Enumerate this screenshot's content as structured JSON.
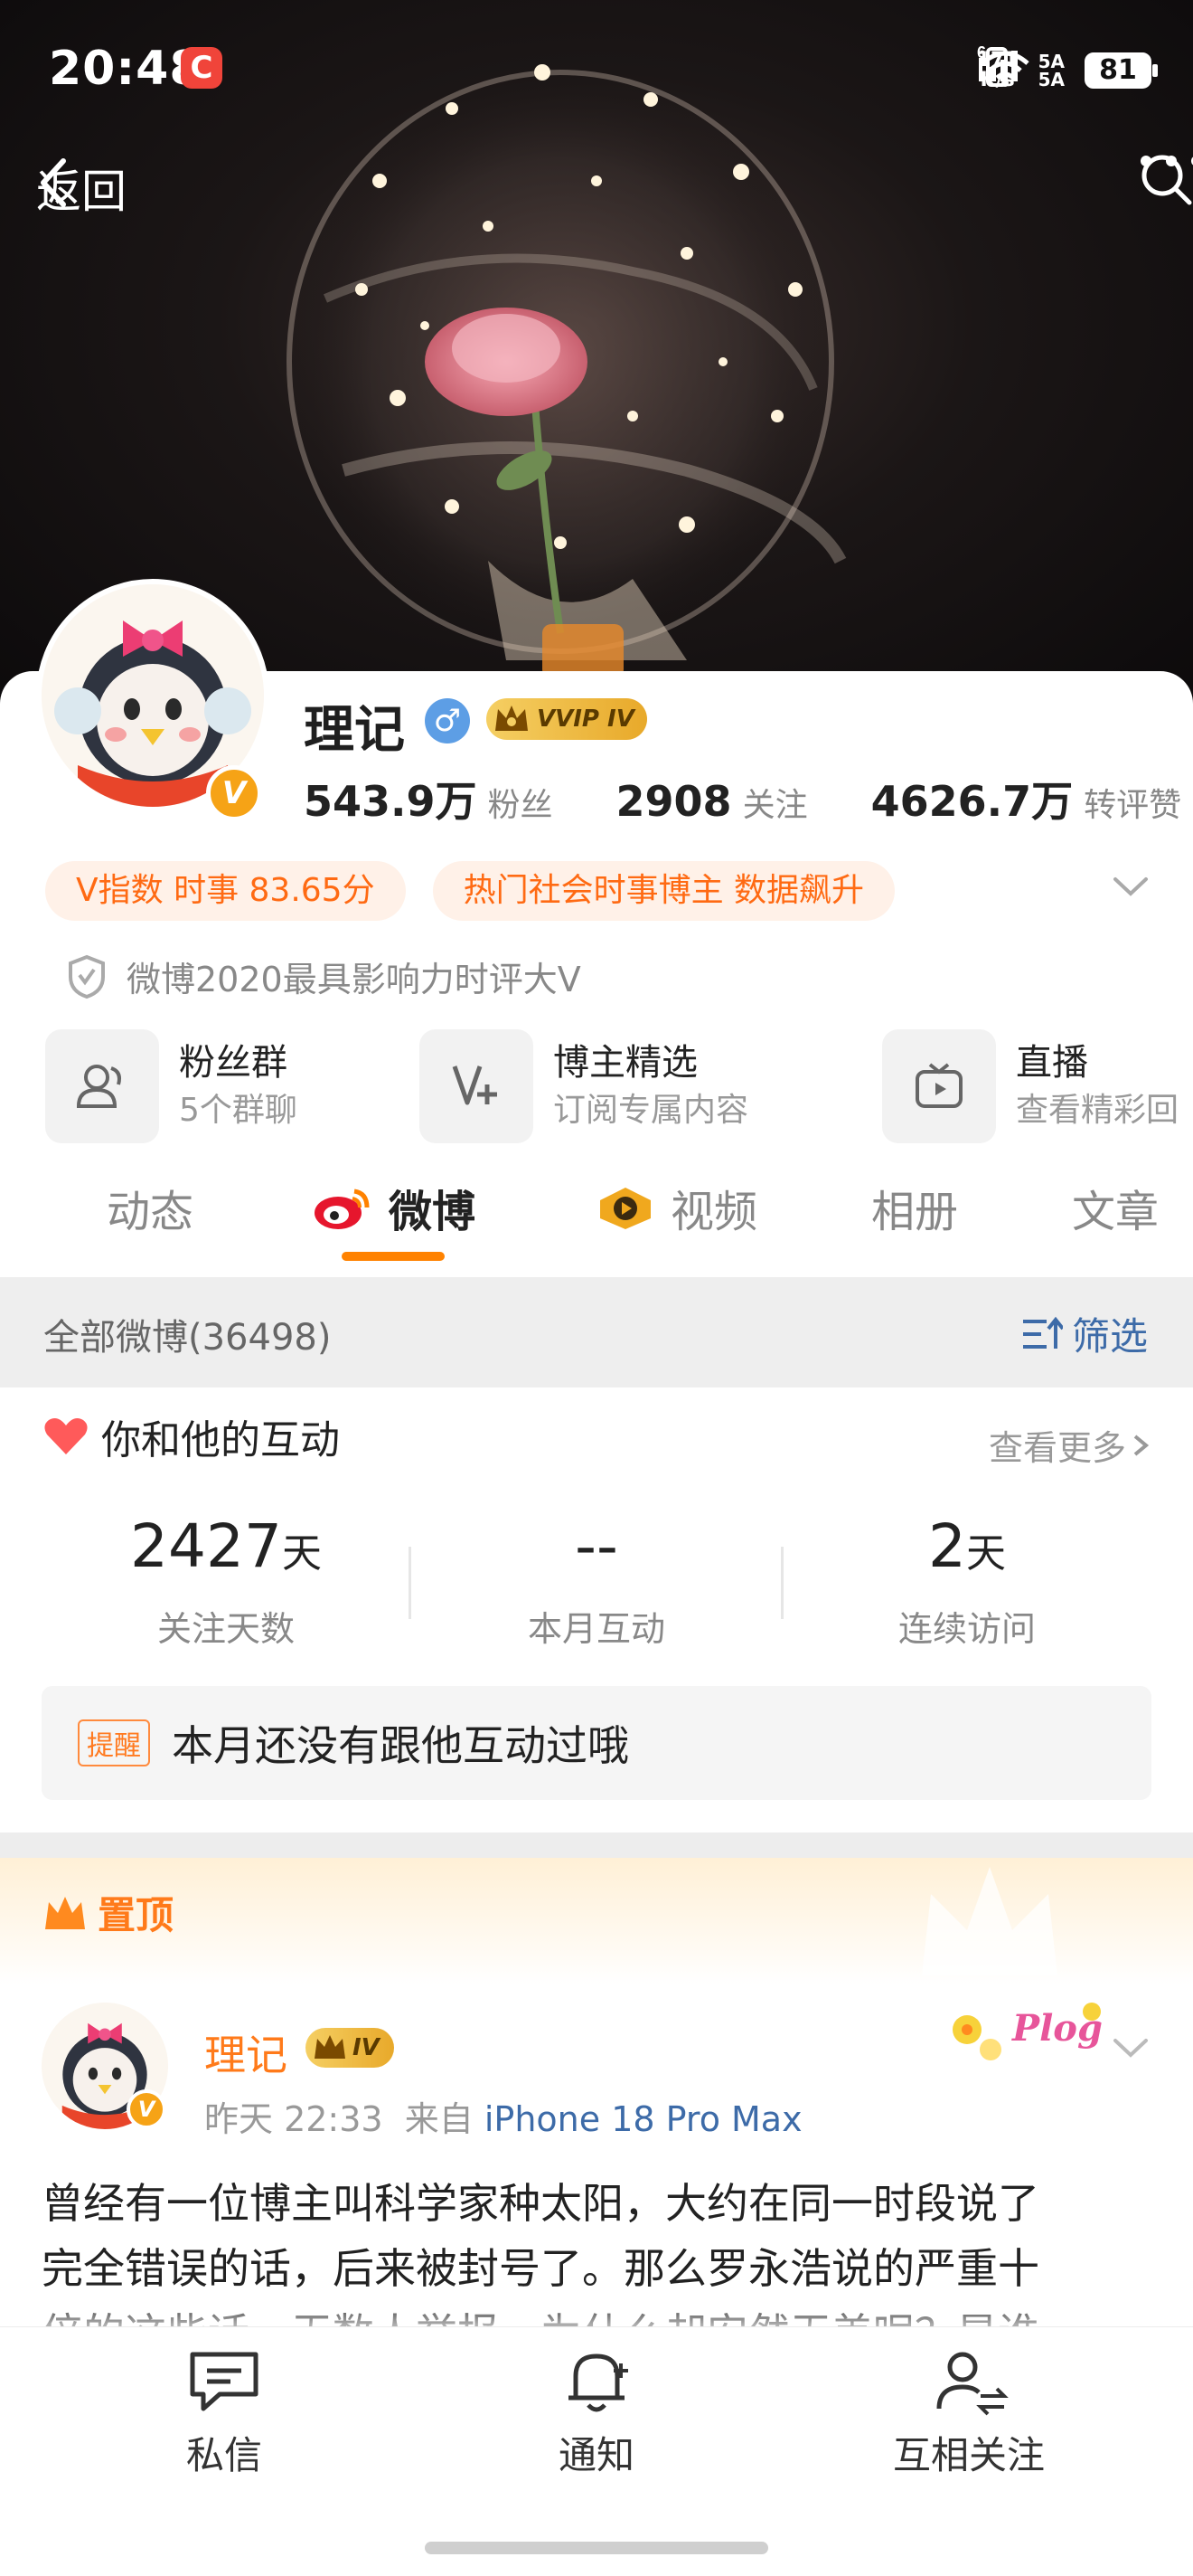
{
  "status_bar": {
    "time": "20:48",
    "app_badge": "C",
    "net_speed_top": "171",
    "net_speed_bottom": "K/s",
    "signal_top": "5A",
    "signal_bottom": "5A",
    "wifi_tag": "6",
    "battery": "81"
  },
  "nav": {
    "back_label": "返回",
    "icons": [
      "search-icon",
      "more-icon"
    ]
  },
  "profile": {
    "name": "理记",
    "vip_badge": "VVIP IV",
    "followers_value": "543.9万",
    "followers_label": "粉丝",
    "following_value": "2908",
    "following_label": "关注",
    "likes_value": "4626.7万",
    "likes_label": "转评赞",
    "tags": [
      "V指数 时事 83.65分",
      "热门社会时事博主 数据飙升"
    ],
    "honor": "微博2020最具影响力时评大V",
    "verified_badge": "V"
  },
  "shortcuts": [
    {
      "title": "粉丝群",
      "subtitle": "5个群聊",
      "icon": "fans-group-icon"
    },
    {
      "title": "博主精选",
      "subtitle": "订阅专属内容",
      "icon": "featured-icon"
    },
    {
      "title": "直播",
      "subtitle": "查看精彩回",
      "icon": "live-icon"
    }
  ],
  "tabs": [
    {
      "label": "动态"
    },
    {
      "label": "微博",
      "active": true
    },
    {
      "label": "视频"
    },
    {
      "label": "相册"
    },
    {
      "label": "文章"
    }
  ],
  "filter": {
    "all_label": "全部微博(36498)",
    "filter_label": "筛选"
  },
  "interaction": {
    "title": "你和他的互动",
    "more": "查看更多",
    "stats": [
      {
        "value": "2427",
        "unit": "天",
        "label": "关注天数"
      },
      {
        "value": "--",
        "unit": "",
        "label": "本月互动"
      },
      {
        "value": "2",
        "unit": "天",
        "label": "连续访问"
      }
    ],
    "remind_tag": "提醒",
    "remind_text": "本月还没有跟他互动过哦"
  },
  "pinned": {
    "label": "置顶",
    "author": "理记",
    "badge": "IV",
    "time": "昨天 22:33",
    "source_prefix": "来自",
    "device": "iPhone 18 Pro Max",
    "plog": "Plog",
    "text_line1": "曾经有一位博主叫科学家种太阳，大约在同一时段说了",
    "text_line2": "完全错误的话，后来被封号了。那么罗永浩说的严重十",
    "text_line3": "倍的这些话，无数人举报，为什么却安然无恙呢？是谁"
  },
  "bottom_bar": [
    {
      "label": "私信",
      "icon": "message-icon"
    },
    {
      "label": "通知",
      "icon": "notification-icon"
    },
    {
      "label": "互相关注",
      "icon": "mutual-follow-icon"
    }
  ],
  "colors": {
    "accent": "#ff8200",
    "link": "#3d6ba8",
    "tag_text": "#ff6a13",
    "tag_bg": "#fff1e8"
  }
}
